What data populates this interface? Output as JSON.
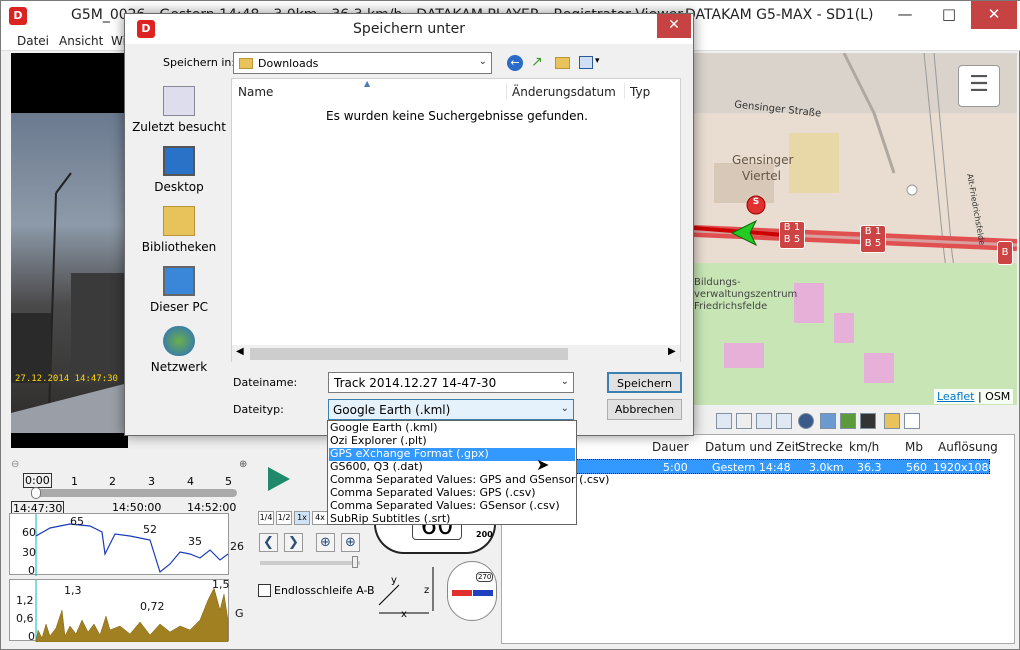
{
  "main": {
    "title_left": "G5M_0026 - Gestern 14:48 - 3.0km - 36.3 km/h - DATAKAM PLAYER - Registrator Viewer",
    "title_right": "DATAKAM G5-MAX - SD1(L)",
    "menu": [
      "Datei",
      "Ansicht",
      "Wi"
    ],
    "video_timestamp": "27.12.2014 14:47:30"
  },
  "dialog": {
    "title": "Speichern unter",
    "save_in_label": "Speichern in:",
    "save_in_value": "Downloads",
    "places": [
      "Zuletzt besucht",
      "Desktop",
      "Bibliotheken",
      "Dieser PC",
      "Netzwerk"
    ],
    "columns": [
      "Name",
      "Änderungsdatum",
      "Typ"
    ],
    "empty_message": "Es wurden keine Suchergebnisse gefunden.",
    "filename_label": "Dateiname:",
    "filename_value": "Track 2014.12.27 14-47-30",
    "filetype_label": "Dateityp:",
    "filetype_value": "Google Earth (.kml)",
    "save_button": "Speichern",
    "cancel_button": "Abbrechen",
    "filetype_options": [
      "Google Earth (.kml)",
      "Ozi Explorer (.plt)",
      "GPS eXchange Format (.gpx)",
      "GS600, Q3 (.dat)",
      "Comma Separated Values: GPS and GSensor (.csv)",
      "Comma Separated Values: GPS (.csv)",
      "Comma Separated Values: GSensor (.csv)",
      "SubRip Subtitles (.srt)"
    ],
    "highlighted_option": "GPS eXchange Format (.gpx)"
  },
  "map": {
    "labels": [
      "Gensinger Straße",
      "Gensinger",
      "Viertel",
      "Alt-Friedrichsfelde",
      "Bildungs-",
      "verwaltungszentrum",
      "Friedrichsfelde",
      "B 1",
      "B 5",
      "B 1",
      "B 5",
      "B"
    ],
    "marker_label": "S",
    "attribution_link": "Leaflet",
    "attribution_text": "| OSM"
  },
  "table": {
    "columns": [
      "Dauer",
      "Datum und Zeit",
      "Strecke",
      "km/h",
      "Mb",
      "Auflösung"
    ],
    "row": [
      "5:00",
      "Gestern 14:48",
      "3.0km",
      "36.3",
      "560",
      "1920x1080"
    ]
  },
  "timeline": {
    "scale": [
      "0:00",
      "1",
      "2",
      "3",
      "4",
      "5"
    ],
    "times": [
      "14:47:30",
      "14:50:00",
      "14:52:00"
    ]
  },
  "speed_graph": {
    "y_ticks": [
      "60",
      "30",
      "0"
    ],
    "peaks": [
      "65",
      "52",
      "35",
      "26"
    ]
  },
  "gsensor_graph": {
    "y_ticks": [
      "1,2",
      "0,6",
      "0"
    ],
    "peaks": [
      "1,3",
      "0,72",
      "1,5"
    ],
    "unit": "G"
  },
  "controls": {
    "speeds": [
      "1/4",
      "1/2",
      "1x",
      "4x"
    ],
    "loop_label": "Endlosschleife A-B",
    "speedo_value": "60",
    "speedo_unit": "200",
    "axes": [
      "y",
      "x",
      "z",
      "x"
    ],
    "compass": "270"
  },
  "colors": {
    "accent": "#3399ff",
    "close": "#c74343",
    "route": "#e05050"
  }
}
